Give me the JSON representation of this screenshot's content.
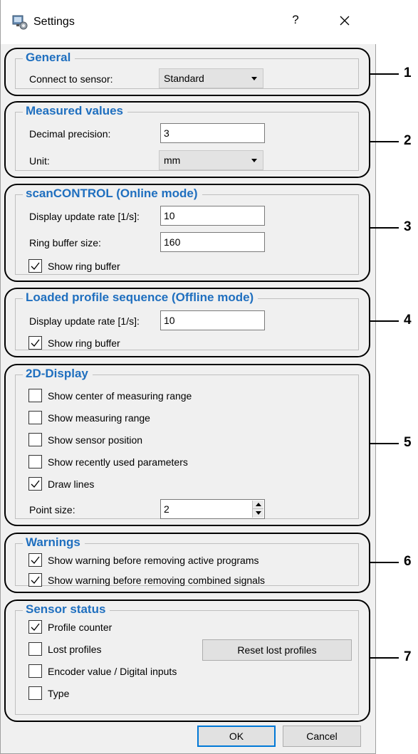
{
  "window": {
    "title": "Settings",
    "help": "?",
    "icon": "settings-app-icon",
    "close_icon": "close-icon"
  },
  "general": {
    "title": "General",
    "connect_label": "Connect to sensor:",
    "connect_value": "Standard"
  },
  "measured": {
    "title": "Measured values",
    "precision_label": "Decimal precision:",
    "precision_value": "3",
    "unit_label": "Unit:",
    "unit_value": "mm"
  },
  "online": {
    "title": "scanCONTROL (Online mode)",
    "rate_label": "Display update rate [1/s]:",
    "rate_value": "10",
    "ring_label": "Ring buffer size:",
    "ring_value": "160",
    "show_ring_label": "Show ring buffer",
    "show_ring_checked": true
  },
  "offline": {
    "title": "Loaded profile sequence (Offline mode)",
    "rate_label": "Display update rate [1/s]:",
    "rate_value": "10",
    "show_ring_label": "Show ring buffer",
    "show_ring_checked": true
  },
  "display2d": {
    "title": "2D-Display",
    "options": [
      {
        "label": "Show center of measuring range",
        "checked": false
      },
      {
        "label": "Show measuring range",
        "checked": false
      },
      {
        "label": "Show sensor position",
        "checked": false
      },
      {
        "label": "Show recently used parameters",
        "checked": false
      },
      {
        "label": "Draw lines",
        "checked": true
      }
    ],
    "point_size_label": "Point size:",
    "point_size_value": "2"
  },
  "warnings": {
    "title": "Warnings",
    "options": [
      {
        "label": "Show warning before removing active programs",
        "checked": true
      },
      {
        "label": "Show warning before removing combined signals",
        "checked": true
      }
    ]
  },
  "sensor_status": {
    "title": "Sensor status",
    "options": [
      {
        "label": "Profile counter",
        "checked": true
      },
      {
        "label": "Lost profiles",
        "checked": false
      },
      {
        "label": "Encoder value / Digital inputs",
        "checked": false
      },
      {
        "label": "Type",
        "checked": false
      }
    ],
    "reset_label": "Reset lost profiles"
  },
  "buttons": {
    "ok": "OK",
    "cancel": "Cancel"
  },
  "callouts": [
    "1",
    "2",
    "3",
    "4",
    "5",
    "6",
    "7"
  ],
  "colors": {
    "group_title": "#1f6fbf",
    "dialog_bg": "#f0f0f0",
    "default_button_border": "#0078d7"
  }
}
